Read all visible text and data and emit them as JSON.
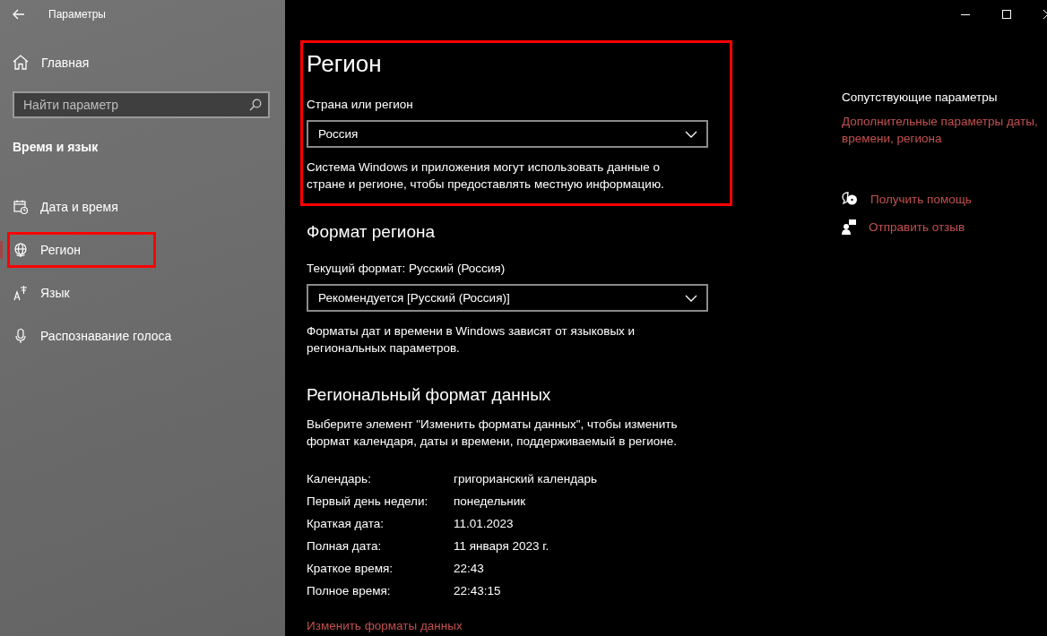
{
  "window": {
    "title": "Параметры"
  },
  "sidebar": {
    "home": "Главная",
    "search": {
      "placeholder": "Найти параметр"
    },
    "section": "Время и язык",
    "items": [
      {
        "label": "Дата и время",
        "kind": "calendar",
        "selected": false,
        "highlighted": false
      },
      {
        "label": "Регион",
        "kind": "globe",
        "selected": true,
        "highlighted": true
      },
      {
        "label": "Язык",
        "kind": "language",
        "selected": false,
        "highlighted": false
      },
      {
        "label": "Распознавание голоса",
        "kind": "microphone",
        "selected": false,
        "highlighted": false
      }
    ]
  },
  "region": {
    "title": "Регион",
    "highlighted": true,
    "country_label": "Страна или регион",
    "country_value": "Россия",
    "description": "Система Windows и приложения могут использовать данные о стране и регионе, чтобы предоставлять местную информацию."
  },
  "region_format": {
    "title": "Формат региона",
    "current_format": "Текущий формат: Русский (Россия)",
    "value": "Рекомендуется [Русский (Россия)]",
    "description": "Форматы дат и времени в Windows зависят от языковых и региональных параметров."
  },
  "regional_data": {
    "title": "Региональный формат данных",
    "description": "Выберите элемент \"Изменить форматы данных\", чтобы изменить формат календаря, даты и времени, поддерживаемый в регионе.",
    "rows": [
      {
        "label": "Календарь:",
        "value": "григорианский календарь"
      },
      {
        "label": "Первый день недели:",
        "value": "понедельник"
      },
      {
        "label": "Краткая дата:",
        "value": "11.01.2023"
      },
      {
        "label": "Полная дата:",
        "value": "11 января 2023 г."
      },
      {
        "label": "Краткое время:",
        "value": "22:43"
      },
      {
        "label": "Полное время:",
        "value": "22:43:15"
      }
    ],
    "link": "Изменить форматы данных"
  },
  "related": {
    "title": "Сопутствующие параметры",
    "link": "Дополнительные параметры даты, времени, региона",
    "actions": [
      {
        "kind": "help",
        "label": "Получить помощь"
      },
      {
        "kind": "feedback",
        "label": "Отправить отзыв"
      }
    ]
  }
}
